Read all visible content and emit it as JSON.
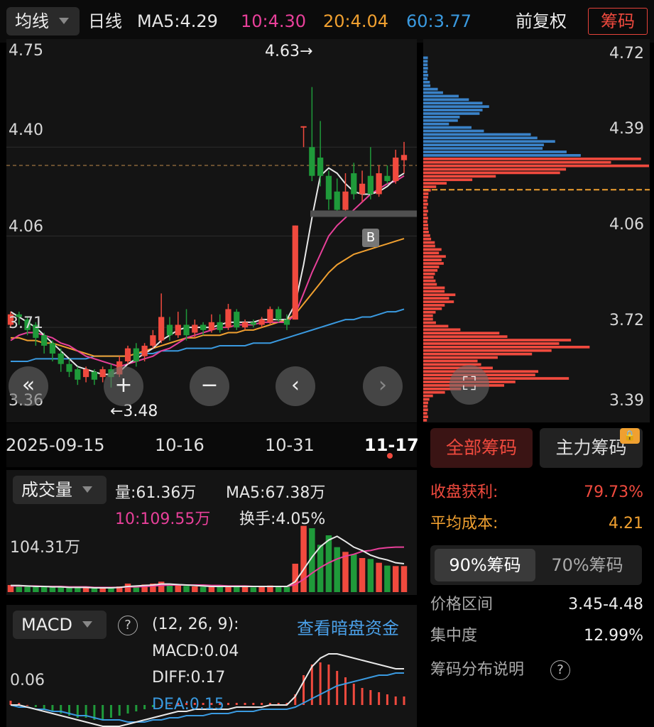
{
  "topbar": {
    "ma_type": "均线",
    "period": "日线",
    "ma5": "MA5:4.29",
    "ma10": "10:4.30",
    "ma20": "20:4.04",
    "ma60": "60:3.77",
    "adjust": "前复权",
    "chips": "筹码"
  },
  "main_chart": {
    "y_labels": [
      "4.75",
      "4.40",
      "4.06",
      "3.71",
      "3.36"
    ],
    "high_marker": "4.63→",
    "low_marker": "←3.48",
    "b_marker": "B",
    "x_labels": [
      "2025-09-15",
      "10-16",
      "10-31",
      "11-17"
    ],
    "nav": [
      "«",
      "+",
      "−",
      "‹",
      "›"
    ],
    "colors": {
      "up": "#f04a3e",
      "down": "#1f9a3a",
      "ma5": "#e8e8e8",
      "ma10": "#e8409a",
      "ma20": "#f0a030",
      "ma60": "#3a9ae0"
    }
  },
  "chart_data": [
    {
      "type": "candlestick",
      "ylim": [
        3.36,
        4.8
      ],
      "y_ticks": [
        4.75,
        4.4,
        4.06,
        3.71,
        3.36
      ],
      "x_ticks": [
        "2025-09-15",
        "10-16",
        "10-31",
        "11-17"
      ],
      "candles": [
        {
          "o": 3.72,
          "c": 3.76,
          "h": 3.77,
          "l": 3.71
        },
        {
          "o": 3.76,
          "c": 3.75,
          "h": 3.77,
          "l": 3.72
        },
        {
          "o": 3.74,
          "c": 3.7,
          "h": 3.75,
          "l": 3.68
        },
        {
          "o": 3.72,
          "c": 3.67,
          "h": 3.73,
          "l": 3.64
        },
        {
          "o": 3.68,
          "c": 3.64,
          "h": 3.69,
          "l": 3.61
        },
        {
          "o": 3.65,
          "c": 3.61,
          "h": 3.66,
          "l": 3.58
        },
        {
          "o": 3.61,
          "c": 3.57,
          "h": 3.63,
          "l": 3.54
        },
        {
          "o": 3.57,
          "c": 3.54,
          "h": 3.59,
          "l": 3.52
        },
        {
          "o": 3.55,
          "c": 3.51,
          "h": 3.56,
          "l": 3.49
        },
        {
          "o": 3.52,
          "c": 3.55,
          "h": 3.56,
          "l": 3.5
        },
        {
          "o": 3.54,
          "c": 3.51,
          "h": 3.55,
          "l": 3.49
        },
        {
          "o": 3.52,
          "c": 3.55,
          "h": 3.56,
          "l": 3.5
        },
        {
          "o": 3.55,
          "c": 3.52,
          "h": 3.57,
          "l": 3.48
        },
        {
          "o": 3.53,
          "c": 3.58,
          "h": 3.6,
          "l": 3.52
        },
        {
          "o": 3.58,
          "c": 3.63,
          "h": 3.64,
          "l": 3.57
        },
        {
          "o": 3.63,
          "c": 3.58,
          "h": 3.65,
          "l": 3.56
        },
        {
          "o": 3.6,
          "c": 3.64,
          "h": 3.65,
          "l": 3.58
        },
        {
          "o": 3.64,
          "c": 3.68,
          "h": 3.7,
          "l": 3.63
        },
        {
          "o": 3.66,
          "c": 3.75,
          "h": 3.84,
          "l": 3.65
        },
        {
          "o": 3.72,
          "c": 3.68,
          "h": 3.75,
          "l": 3.66
        },
        {
          "o": 3.68,
          "c": 3.72,
          "h": 3.77,
          "l": 3.67
        },
        {
          "o": 3.72,
          "c": 3.68,
          "h": 3.78,
          "l": 3.66
        },
        {
          "o": 3.69,
          "c": 3.72,
          "h": 3.74,
          "l": 3.67
        },
        {
          "o": 3.72,
          "c": 3.7,
          "h": 3.73,
          "l": 3.68
        },
        {
          "o": 3.7,
          "c": 3.73,
          "h": 3.76,
          "l": 3.69
        },
        {
          "o": 3.73,
          "c": 3.7,
          "h": 3.76,
          "l": 3.69
        },
        {
          "o": 3.71,
          "c": 3.78,
          "h": 3.8,
          "l": 3.7
        },
        {
          "o": 3.77,
          "c": 3.71,
          "h": 3.78,
          "l": 3.7
        },
        {
          "o": 3.71,
          "c": 3.73,
          "h": 3.74,
          "l": 3.7
        },
        {
          "o": 3.73,
          "c": 3.72,
          "h": 3.74,
          "l": 3.71
        },
        {
          "o": 3.72,
          "c": 3.74,
          "h": 3.75,
          "l": 3.71
        },
        {
          "o": 3.73,
          "c": 3.78,
          "h": 3.79,
          "l": 3.72
        },
        {
          "o": 3.78,
          "c": 3.74,
          "h": 3.79,
          "l": 3.73
        },
        {
          "o": 3.74,
          "c": 3.72,
          "h": 3.76,
          "l": 3.7
        },
        {
          "o": 3.74,
          "c": 4.1,
          "h": 4.1,
          "l": 3.74
        },
        {
          "o": 4.48,
          "c": 4.48,
          "h": 4.48,
          "l": 4.4
        },
        {
          "o": 4.4,
          "c": 4.29,
          "h": 4.63,
          "l": 4.27
        },
        {
          "o": 4.36,
          "c": 4.29,
          "h": 4.5,
          "l": 4.25
        },
        {
          "o": 4.29,
          "c": 4.2,
          "h": 4.31,
          "l": 4.16
        },
        {
          "o": 4.23,
          "c": 4.16,
          "h": 4.28,
          "l": 4.14
        },
        {
          "o": 4.16,
          "c": 4.23,
          "h": 4.3,
          "l": 4.15
        },
        {
          "o": 4.3,
          "c": 4.22,
          "h": 4.34,
          "l": 4.2
        },
        {
          "o": 4.22,
          "c": 4.26,
          "h": 4.31,
          "l": 4.19
        },
        {
          "o": 4.29,
          "c": 4.22,
          "h": 4.4,
          "l": 4.2
        },
        {
          "o": 4.22,
          "c": 4.3,
          "h": 4.33,
          "l": 4.21
        },
        {
          "o": 4.29,
          "c": 4.27,
          "h": 4.33,
          "l": 4.26
        },
        {
          "o": 4.27,
          "c": 4.36,
          "h": 4.39,
          "l": 4.26
        },
        {
          "o": 4.35,
          "c": 4.37,
          "h": 4.42,
          "l": 4.3
        }
      ],
      "ma5": [
        3.77,
        3.75,
        3.73,
        3.71,
        3.68,
        3.65,
        3.62,
        3.59,
        3.56,
        3.55,
        3.54,
        3.53,
        3.53,
        3.54,
        3.57,
        3.59,
        3.61,
        3.63,
        3.66,
        3.68,
        3.7,
        3.71,
        3.71,
        3.71,
        3.71,
        3.72,
        3.73,
        3.73,
        3.73,
        3.73,
        3.74,
        3.74,
        3.74,
        3.74,
        3.8,
        3.95,
        4.13,
        4.29,
        4.32,
        4.3,
        4.26,
        4.23,
        4.22,
        4.22,
        4.23,
        4.25,
        4.28,
        4.3
      ],
      "ma10": [
        3.66,
        3.68,
        3.69,
        3.69,
        3.68,
        3.67,
        3.65,
        3.64,
        3.62,
        3.6,
        3.59,
        3.58,
        3.57,
        3.56,
        3.57,
        3.58,
        3.59,
        3.6,
        3.62,
        3.63,
        3.65,
        3.67,
        3.68,
        3.69,
        3.7,
        3.71,
        3.71,
        3.72,
        3.72,
        3.72,
        3.73,
        3.73,
        3.73,
        3.73,
        3.76,
        3.84,
        3.92,
        3.99,
        4.06,
        4.1,
        4.13,
        4.16,
        4.19,
        4.22,
        4.24,
        4.26,
        4.27,
        4.29
      ],
      "ma20": [
        3.67,
        3.67,
        3.66,
        3.66,
        3.65,
        3.65,
        3.64,
        3.63,
        3.62,
        3.61,
        3.6,
        3.6,
        3.6,
        3.6,
        3.6,
        3.61,
        3.62,
        3.63,
        3.64,
        3.65,
        3.66,
        3.67,
        3.67,
        3.68,
        3.68,
        3.68,
        3.69,
        3.69,
        3.7,
        3.7,
        3.71,
        3.72,
        3.73,
        3.74,
        3.76,
        3.8,
        3.84,
        3.88,
        3.92,
        3.95,
        3.97,
        3.99,
        4.0,
        4.01,
        4.02,
        4.03,
        4.04,
        4.05
      ],
      "ma60": [
        3.58,
        3.58,
        3.58,
        3.59,
        3.59,
        3.59,
        3.59,
        3.59,
        3.59,
        3.59,
        3.6,
        3.6,
        3.6,
        3.6,
        3.6,
        3.61,
        3.61,
        3.61,
        3.62,
        3.62,
        3.62,
        3.63,
        3.63,
        3.63,
        3.63,
        3.64,
        3.64,
        3.64,
        3.64,
        3.65,
        3.65,
        3.65,
        3.66,
        3.67,
        3.68,
        3.69,
        3.7,
        3.71,
        3.72,
        3.73,
        3.74,
        3.74,
        3.75,
        3.75,
        3.76,
        3.77,
        3.77,
        3.78
      ]
    },
    {
      "type": "bar",
      "name": "volume",
      "values": [
        15,
        12,
        12,
        11,
        12,
        12,
        10,
        10,
        9,
        9,
        9,
        8,
        9,
        12,
        18,
        12,
        16,
        18,
        22,
        16,
        14,
        13,
        12,
        11,
        12,
        11,
        14,
        12,
        11,
        10,
        11,
        14,
        12,
        12,
        60,
        140,
        135,
        100,
        120,
        95,
        85,
        80,
        72,
        70,
        62,
        56,
        55,
        55
      ],
      "up": [
        1,
        0,
        0,
        0,
        0,
        0,
        0,
        0,
        0,
        1,
        0,
        1,
        0,
        1,
        1,
        0,
        1,
        1,
        1,
        0,
        1,
        0,
        1,
        0,
        1,
        0,
        1,
        0,
        1,
        0,
        1,
        1,
        0,
        0,
        1,
        1,
        0,
        0,
        0,
        0,
        1,
        0,
        1,
        0,
        1,
        0,
        1,
        1
      ],
      "ma5": [
        14,
        14,
        13,
        12,
        12,
        11,
        11,
        10,
        10,
        10,
        9,
        9,
        9,
        10,
        12,
        13,
        14,
        15,
        17,
        17,
        16,
        15,
        14,
        13,
        12,
        12,
        12,
        12,
        12,
        12,
        12,
        12,
        12,
        12,
        22,
        48,
        74,
        96,
        110,
        118,
        107,
        95,
        88,
        78,
        72,
        68,
        62,
        60
      ],
      "ma10": [
        13,
        13,
        13,
        13,
        12,
        12,
        12,
        11,
        11,
        11,
        10,
        10,
        10,
        10,
        11,
        11,
        12,
        13,
        14,
        15,
        15,
        15,
        15,
        15,
        14,
        14,
        13,
        13,
        13,
        12,
        12,
        12,
        12,
        12,
        16,
        27,
        40,
        52,
        62,
        70,
        76,
        80,
        86,
        88,
        92,
        94,
        95,
        95
      ]
    },
    {
      "type": "bar",
      "name": "macd",
      "values": [
        0.02,
        0.01,
        0.0,
        -0.01,
        -0.02,
        -0.03,
        -0.04,
        -0.05,
        -0.06,
        -0.06,
        -0.07,
        -0.07,
        -0.06,
        -0.05,
        -0.04,
        -0.03,
        -0.02,
        -0.01,
        0.0,
        0.0,
        0.01,
        0.01,
        0.01,
        0.01,
        0.01,
        0.01,
        0.01,
        0.01,
        0.01,
        0.01,
        0.01,
        0.01,
        0.01,
        0.01,
        0.05,
        0.14,
        0.19,
        0.2,
        0.19,
        0.16,
        0.13,
        0.1,
        0.08,
        0.07,
        0.06,
        0.05,
        0.04,
        0.04
      ],
      "diff": [
        0.0,
        0.0,
        -0.01,
        -0.02,
        -0.03,
        -0.04,
        -0.05,
        -0.06,
        -0.07,
        -0.08,
        -0.09,
        -0.1,
        -0.1,
        -0.1,
        -0.09,
        -0.08,
        -0.07,
        -0.06,
        -0.05,
        -0.04,
        -0.03,
        -0.03,
        -0.02,
        -0.02,
        -0.02,
        -0.02,
        -0.02,
        -0.01,
        -0.01,
        -0.01,
        -0.01,
        0.0,
        0.0,
        0.0,
        0.04,
        0.11,
        0.18,
        0.22,
        0.24,
        0.24,
        0.23,
        0.22,
        0.21,
        0.2,
        0.19,
        0.18,
        0.17,
        0.17
      ],
      "dea": [
        0.0,
        -0.01,
        -0.01,
        -0.02,
        -0.02,
        -0.03,
        -0.03,
        -0.04,
        -0.05,
        -0.05,
        -0.06,
        -0.07,
        -0.07,
        -0.07,
        -0.08,
        -0.08,
        -0.08,
        -0.07,
        -0.07,
        -0.06,
        -0.06,
        -0.05,
        -0.05,
        -0.05,
        -0.04,
        -0.04,
        -0.04,
        -0.03,
        -0.03,
        -0.03,
        -0.02,
        -0.02,
        -0.02,
        -0.02,
        -0.01,
        0.01,
        0.03,
        0.05,
        0.07,
        0.09,
        0.1,
        0.11,
        0.12,
        0.13,
        0.14,
        0.14,
        0.15,
        0.15
      ]
    },
    {
      "type": "bar",
      "name": "chip-distribution",
      "orientation": "horizontal",
      "price_range": [
        3.33,
        4.78
      ],
      "cost_price": 4.21,
      "profit_split_price": 4.33
    }
  ],
  "volume": {
    "selector": "成交量",
    "vol": "量:61.36万",
    "ma5": "MA5:67.38万",
    "ma10": "10:109.55万",
    "turnover": "换手:4.05%",
    "y_label": "104.31万"
  },
  "macd": {
    "selector": "MACD",
    "help": "?",
    "params": "(12, 26, 9):",
    "link": "查看暗盘资金",
    "macd": "MACD:0.04",
    "diff": "DIFF:0.17",
    "dea": "DEA:0.15",
    "y_label": "0.06"
  },
  "chips": {
    "y_labels": [
      "4.72",
      "4.39",
      "4.06",
      "3.72",
      "3.39"
    ],
    "tab_all": "全部筹码",
    "tab_main": "主力筹码",
    "profit_label": "收盘获利:",
    "profit_value": "79.73%",
    "avg_cost_label": "平均成本:",
    "avg_cost_value": "4.21",
    "tab_90": "90%筹码",
    "tab_70": "70%筹码",
    "range_label": "价格区间",
    "range_value": "3.45-4.48",
    "conc_label": "集中度",
    "conc_value": "12.99%",
    "explain": "筹码分布说明",
    "explain_help": "?"
  }
}
